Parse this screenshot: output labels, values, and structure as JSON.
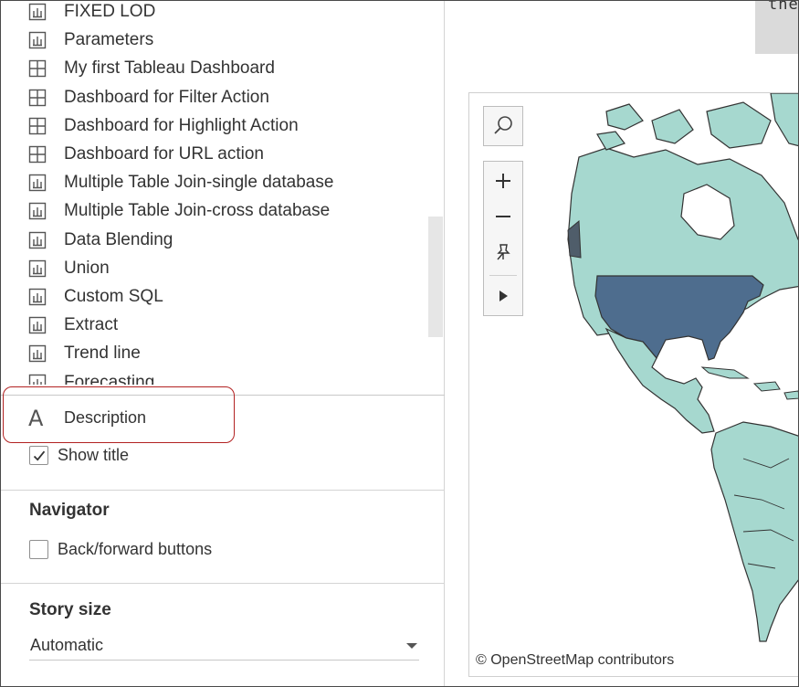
{
  "sheet_list": {
    "items": [
      {
        "label": "FIXED LOD",
        "icon": "worksheet-icon"
      },
      {
        "label": "Parameters",
        "icon": "worksheet-icon"
      },
      {
        "label": "My first Tableau Dashboard",
        "icon": "dashboard-icon"
      },
      {
        "label": "Dashboard for Filter Action",
        "icon": "dashboard-icon"
      },
      {
        "label": "Dashboard for Highlight Action",
        "icon": "dashboard-icon"
      },
      {
        "label": "Dashboard for URL action",
        "icon": "dashboard-icon"
      },
      {
        "label": "Multiple Table Join-single database",
        "icon": "worksheet-icon"
      },
      {
        "label": "Multiple Table Join-cross database",
        "icon": "worksheet-icon"
      },
      {
        "label": "Data Blending",
        "icon": "worksheet-icon"
      },
      {
        "label": "Union",
        "icon": "worksheet-icon"
      },
      {
        "label": "Custom SQL",
        "icon": "worksheet-icon"
      },
      {
        "label": "Extract",
        "icon": "worksheet-icon"
      },
      {
        "label": "Trend line",
        "icon": "worksheet-icon"
      },
      {
        "label": "Forecasting",
        "icon": "worksheet-icon"
      }
    ]
  },
  "description": {
    "icon_glyph": "A",
    "label": "Description"
  },
  "show_title": {
    "label": "Show title",
    "checked": true
  },
  "navigator": {
    "heading": "Navigator",
    "back_forward_label": "Back/forward buttons",
    "back_forward_checked": false
  },
  "story_size": {
    "heading": "Story size",
    "value": "Automatic"
  },
  "caption": {
    "text": "the"
  },
  "map": {
    "attribution": "© OpenStreetMap contributors",
    "highlight_color": "#4e6d8e",
    "land_color": "#a6d8cf",
    "water_color": "#ffffff"
  },
  "colors": {
    "annotation_border": "#b22222",
    "panel_divider": "#d4d4d4"
  }
}
